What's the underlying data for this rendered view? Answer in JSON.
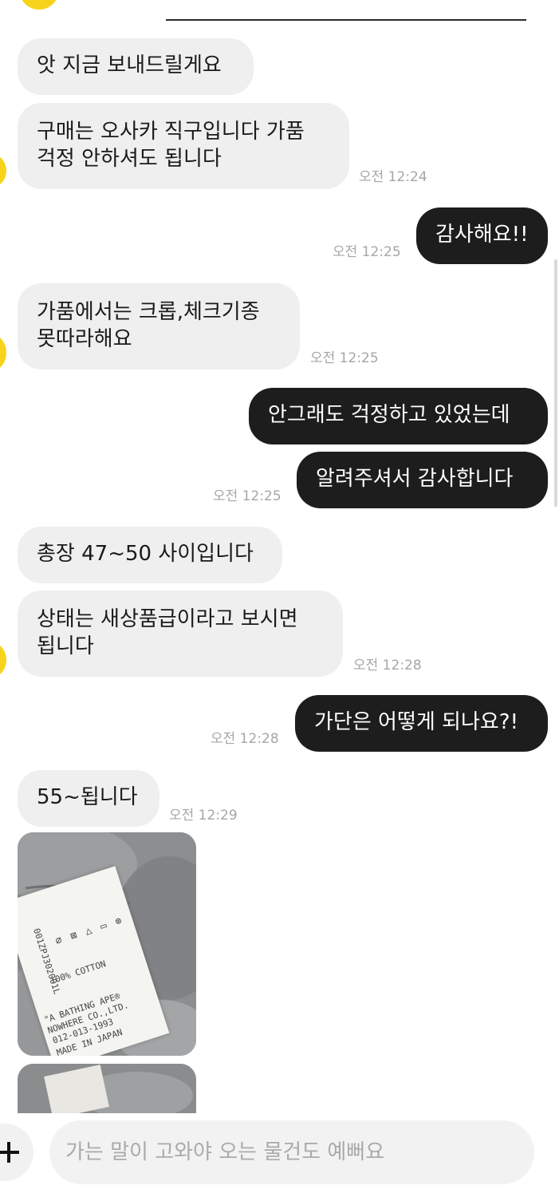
{
  "messages": [
    {
      "text": "앗 지금 보내드릴게요"
    },
    {
      "text": "구매는 오사카 직구입니다 가품\n걱정 안하셔도 됩니다",
      "time": "오전 12:24"
    },
    {
      "text": "감사해요!!",
      "time": "오전 12:25"
    },
    {
      "text": "가품에서는 크롭,체크기종\n못따라해요",
      "time": "오전 12:25"
    },
    {
      "text": "안그래도 걱정하고 있었는데"
    },
    {
      "text": "알려주셔서 감사합니다",
      "time": "오전 12:25"
    },
    {
      "text": "총장 47~50 사이입니다"
    },
    {
      "text": "상태는 새상품급이라고 보시면\n됩니다",
      "time": "오전 12:28"
    },
    {
      "text": "가단은 어떻게 되나요?!",
      "time": "오전 12:28"
    },
    {
      "text": "55~됩니다",
      "time": "오전 12:29"
    }
  ],
  "photo": {
    "label_lines": [
      "001ZPJ302001L",
      "100% COTTON",
      "\"A BATHING APE®",
      "NOWHERE CO.,LTD.",
      "012-013-1993",
      "MADE IN JAPAN"
    ]
  },
  "composer": {
    "placeholder": "가는 말이 고와야 오는 물건도 예뻐요"
  },
  "colors": {
    "incoming_bubble": "#efefef",
    "outgoing_bubble": "#1d1d1d",
    "avatar": "#f7d31c"
  }
}
